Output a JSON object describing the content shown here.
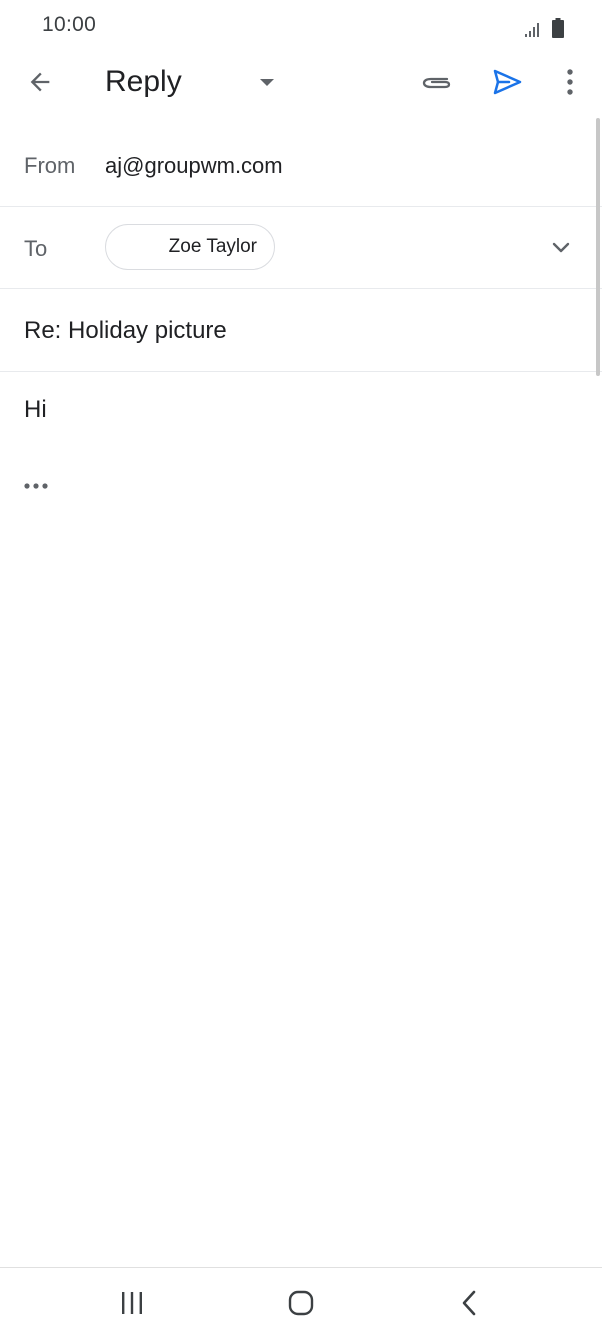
{
  "status_bar": {
    "time": "10:00",
    "icons": [
      "signal-icon",
      "battery-icon"
    ]
  },
  "toolbar": {
    "title": "Reply",
    "icons": [
      "back-arrow-icon",
      "dropdown-caret-icon",
      "paperclip-icon",
      "send-icon",
      "more-vert-icon"
    ],
    "accent_color": "#1a73e8"
  },
  "compose": {
    "from_label": "From",
    "from_value": "aj@groupwm.com",
    "to_label": "To",
    "recipients": [
      "Zoe Taylor"
    ],
    "subject": "Re: Holiday picture",
    "body": "Hi",
    "quoted_icon": "ellipsis-icon"
  },
  "nav_bar": {
    "icons": [
      "recents-icon",
      "home-icon",
      "back-icon"
    ]
  }
}
